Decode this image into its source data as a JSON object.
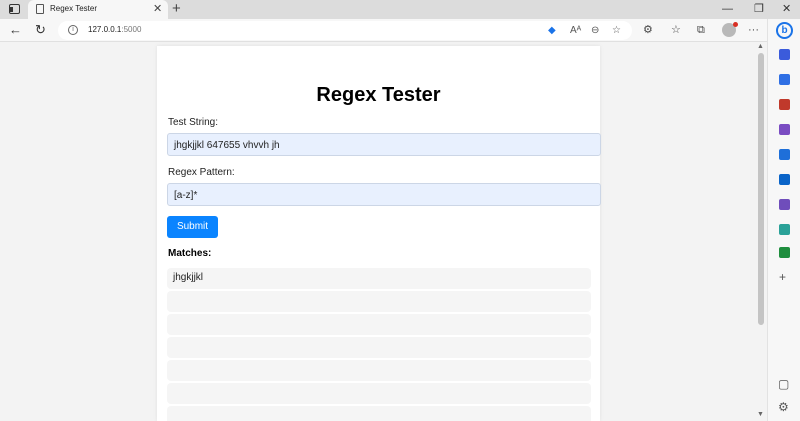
{
  "browser": {
    "tab": {
      "title": "Regex Tester",
      "close_glyph": "✕"
    },
    "new_tab_glyph": "+",
    "window_controls": {
      "minimize": "—",
      "maximize": "❐",
      "close": "✕"
    },
    "nav": {
      "back": "←",
      "refresh": "↻"
    },
    "address": {
      "host": "127.0.0.1",
      "port": ":5000"
    },
    "address_icons": [
      "tag-icon",
      "read-aloud-icon",
      "zoom-icon",
      "favorite-add-icon"
    ],
    "toolbar_icons": [
      "extensions-icon",
      "favorites-icon",
      "collections-icon",
      "profile-icon",
      "more-icon"
    ],
    "more_glyph": "···",
    "read_aloud_glyph": "Aᴬ",
    "sidebar": {
      "bing_glyph": "b",
      "icons": [
        {
          "name": "search-icon",
          "color": "#3b5bdb"
        },
        {
          "name": "shopping-icon",
          "color": "#2f6fe4"
        },
        {
          "name": "tools-icon",
          "color": "#c0392b"
        },
        {
          "name": "games-icon",
          "color": "#7a4cc2"
        },
        {
          "name": "office-icon",
          "color": "#1e6fd9"
        },
        {
          "name": "outlook-icon",
          "color": "#0a64c8"
        },
        {
          "name": "drop-icon",
          "color": "#6f4dbb"
        },
        {
          "name": "designer-icon",
          "color": "#2aa198"
        },
        {
          "name": "tree-icon",
          "color": "#1e8e3e"
        }
      ],
      "add_glyph": "+"
    }
  },
  "page": {
    "title": "Regex Tester",
    "test_string_label": "Test String:",
    "test_string_value": "jhgkjjkl 647655 vhvvh jh",
    "pattern_label": "Regex Pattern:",
    "pattern_value": "[a-z]*",
    "submit_label": "Submit",
    "matches_label": "Matches:",
    "matches": [
      "jhgkjjkl",
      "",
      "",
      "",
      "",
      "",
      "",
      "",
      "",
      ""
    ]
  },
  "colors": {
    "accent": "#0a84ff",
    "field_bg": "#e8f0fe",
    "match_bg": "#f5f5f5"
  }
}
